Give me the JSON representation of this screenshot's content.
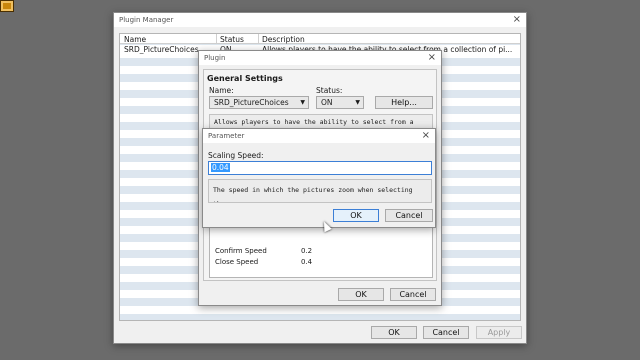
{
  "plugin_manager": {
    "title": "Plugin Manager",
    "columns": [
      "Name",
      "Status",
      "Description"
    ],
    "rows": [
      {
        "name": "SRD_PictureChoices",
        "status": "ON",
        "description": "Allows players to have the ability to select from a collection of pi..."
      }
    ],
    "buttons": {
      "ok": "OK",
      "cancel": "Cancel",
      "apply": "Apply"
    }
  },
  "plugin_dialog": {
    "title": "Plugin",
    "section": "General Settings",
    "name_label": "Name:",
    "name_value": "SRD_PictureChoices",
    "status_label": "Status:",
    "status_value": "ON",
    "help_button": "Help...",
    "description": "Allows players to have the ability to select from a",
    "parameters": [
      {
        "key": "Confirm Speed",
        "value": "0.2"
      },
      {
        "key": "Close Speed",
        "value": "0.4"
      }
    ],
    "buttons": {
      "ok": "OK",
      "cancel": "Cancel"
    }
  },
  "parameter_dialog": {
    "title": "Parameter",
    "field_label": "Scaling Speed:",
    "field_value": "0.04",
    "description": "The speed in which the pictures zoom when selecting them.",
    "buttons": {
      "ok": "OK",
      "cancel": "Cancel"
    }
  }
}
